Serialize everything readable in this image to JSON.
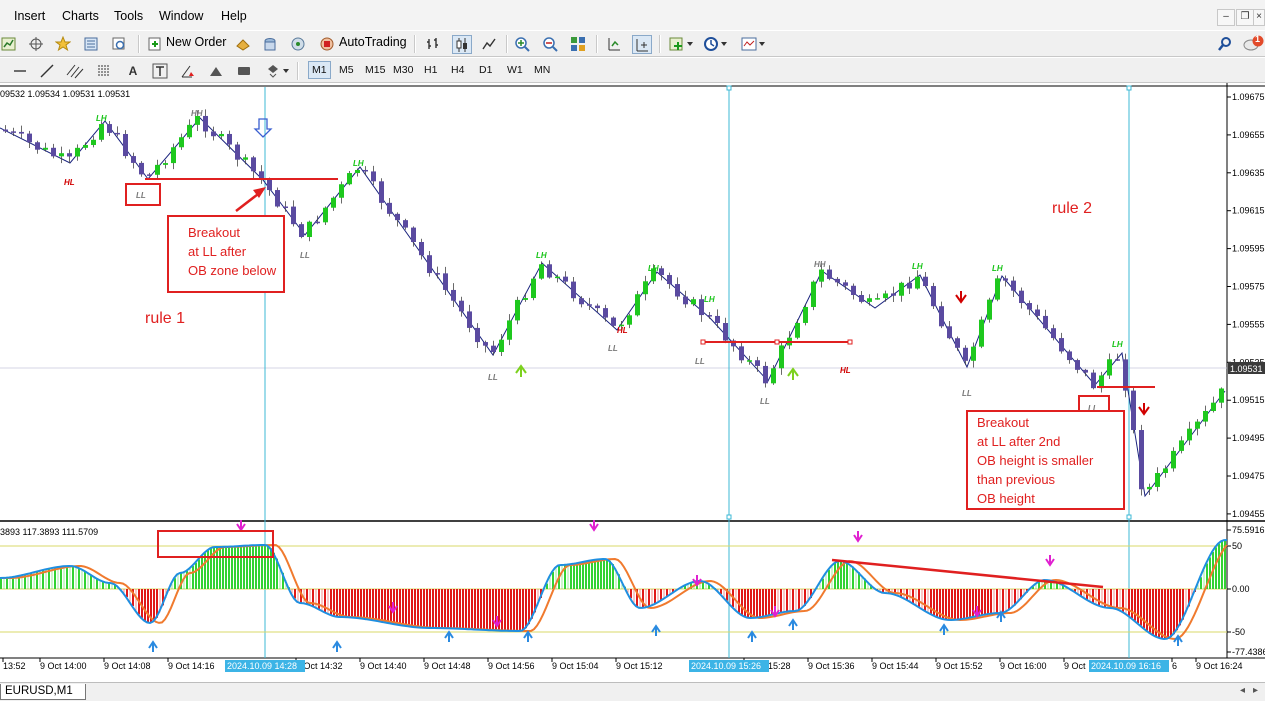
{
  "menu": [
    "Insert",
    "Charts",
    "Tools",
    "Window",
    "Help"
  ],
  "window_controls": [
    "minimize-icon",
    "restore-icon",
    "close-icon"
  ],
  "toolbar1": {
    "new_order": "New Order",
    "autotrading": "AutoTrading",
    "notification_badge": "1"
  },
  "timeframes": [
    "M1",
    "M5",
    "M15",
    "M30",
    "H1",
    "H4",
    "D1",
    "W1",
    "MN"
  ],
  "active_timeframe": "M1",
  "chart": {
    "ohlc_header": "09532 1.09534 1.09531 1.09531",
    "symbol_tab": "EURUSD,M1",
    "current_price": "1.09531",
    "price_axis": [
      "1.09675",
      "1.09655",
      "1.09635",
      "1.09615",
      "1.09595",
      "1.09575",
      "1.09555",
      "1.09535",
      "1.09515",
      "1.09495",
      "1.09475",
      "1.09455"
    ],
    "swing_labels": [
      {
        "text": "HL",
        "color": "#d10000"
      },
      {
        "text": "LH",
        "color": "#18c418"
      },
      {
        "text": "HH",
        "color": "#7a7a7a"
      },
      {
        "text": "LL",
        "color": "#7a7a7a"
      },
      {
        "text": "LH",
        "color": "#18c418"
      },
      {
        "text": "LL",
        "color": "#7a7a7a"
      },
      {
        "text": "LH",
        "color": "#18c418"
      },
      {
        "text": "LL",
        "color": "#7a7a7a"
      },
      {
        "text": "LH",
        "color": "#18c418"
      },
      {
        "text": "HL",
        "color": "#d10000"
      },
      {
        "text": "LH",
        "color": "#18c418"
      },
      {
        "text": "LL",
        "color": "#7a7a7a"
      },
      {
        "text": "LL",
        "color": "#7a7a7a"
      },
      {
        "text": "HH",
        "color": "#7a7a7a"
      },
      {
        "text": "HL",
        "color": "#d10000"
      },
      {
        "text": "LH",
        "color": "#18c418"
      },
      {
        "text": "LL",
        "color": "#7a7a7a"
      },
      {
        "text": "LH",
        "color": "#18c418"
      },
      {
        "text": "LH",
        "color": "#18c418"
      },
      {
        "text": "LL",
        "color": "#7a7a7a"
      }
    ],
    "annotations": {
      "rule1": "rule 1",
      "rule2": "rule 2",
      "box1": [
        "Breakout",
        "at LL after",
        "OB zone below"
      ],
      "box2": [
        "Breakout",
        "at LL after 2nd",
        "OB height is smaller",
        "than previous",
        "OB height"
      ]
    }
  },
  "oscillator": {
    "header": "3893 117.3893 111.5709",
    "axis": [
      "75.5916",
      "50",
      "0.00",
      "-50",
      "-77.4386"
    ]
  },
  "time_axis": [
    "13:52",
    "9 Oct 14:00",
    "9 Oct 14:08",
    "9 Oct 14:16",
    "9 Oct 14:32",
    "9 Oct 14:40",
    "9 Oct 14:48",
    "9 Oct 14:56",
    "9 Oct 15:04",
    "9 Oct 15:12",
    "9 Oct 15:28",
    "9 Oct 15:36",
    "9 Oct 15:44",
    "9 Oct 15:52",
    "9 Oct 16:00",
    "9 Oct",
    "6",
    "9 Oct 16:24"
  ],
  "time_highlights": [
    "2024.10.09 14:28",
    "2024.10.09 15:26",
    "2024.10.09 16:16"
  ],
  "colors": {
    "bull": "#1ec81e",
    "bear": "#5a4aa0",
    "zigzag": "#1a237e",
    "annotation": "#e02020",
    "vline": "#3cb9d6",
    "hist_up": "#32d232",
    "hist_down": "#e01818",
    "osc_blue": "#1f8fe0",
    "osc_orange": "#f07a2e",
    "level": "#d9d96a"
  }
}
